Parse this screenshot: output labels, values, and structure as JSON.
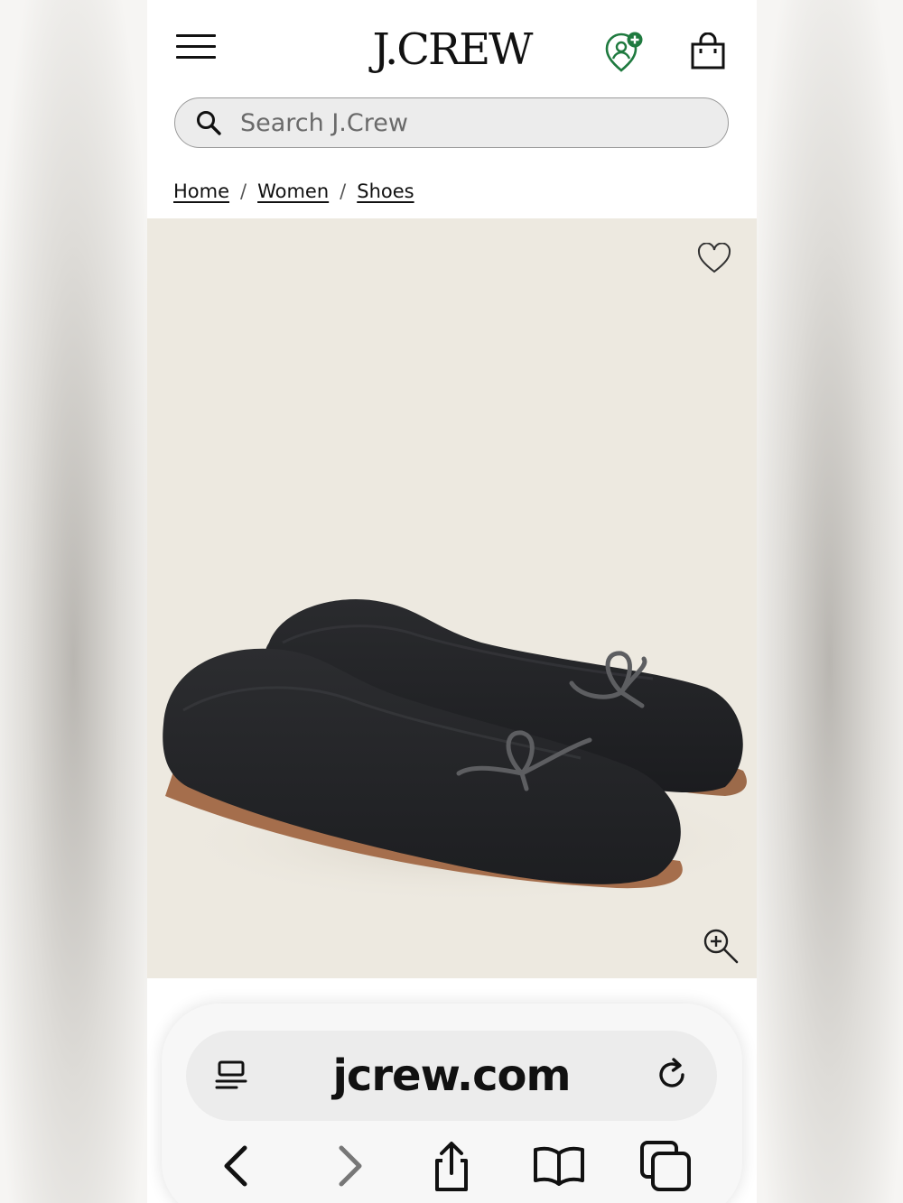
{
  "header": {
    "logo": "J.CREW",
    "menu_icon": "hamburger-menu-icon",
    "account_icon": "account-add-icon",
    "bag_icon": "shopping-bag-icon",
    "accent_color": "#1f7a3f"
  },
  "search": {
    "placeholder": "Search J.Crew",
    "icon": "search-icon"
  },
  "breadcrumb": {
    "items": [
      "Home",
      "Women",
      "Shoes"
    ],
    "separator": "/"
  },
  "product": {
    "background_color": "#ede9e0",
    "wishlist_icon": "heart-outline-icon",
    "zoom_icon": "zoom-in-icon"
  },
  "browser": {
    "url": "jcrew.com",
    "reader_icon": "reader-mode-icon",
    "reload_icon": "reload-icon",
    "nav_icons": [
      "back-arrow-icon",
      "forward-arrow-icon",
      "share-icon",
      "bookmarks-icon",
      "tabs-icon"
    ]
  }
}
